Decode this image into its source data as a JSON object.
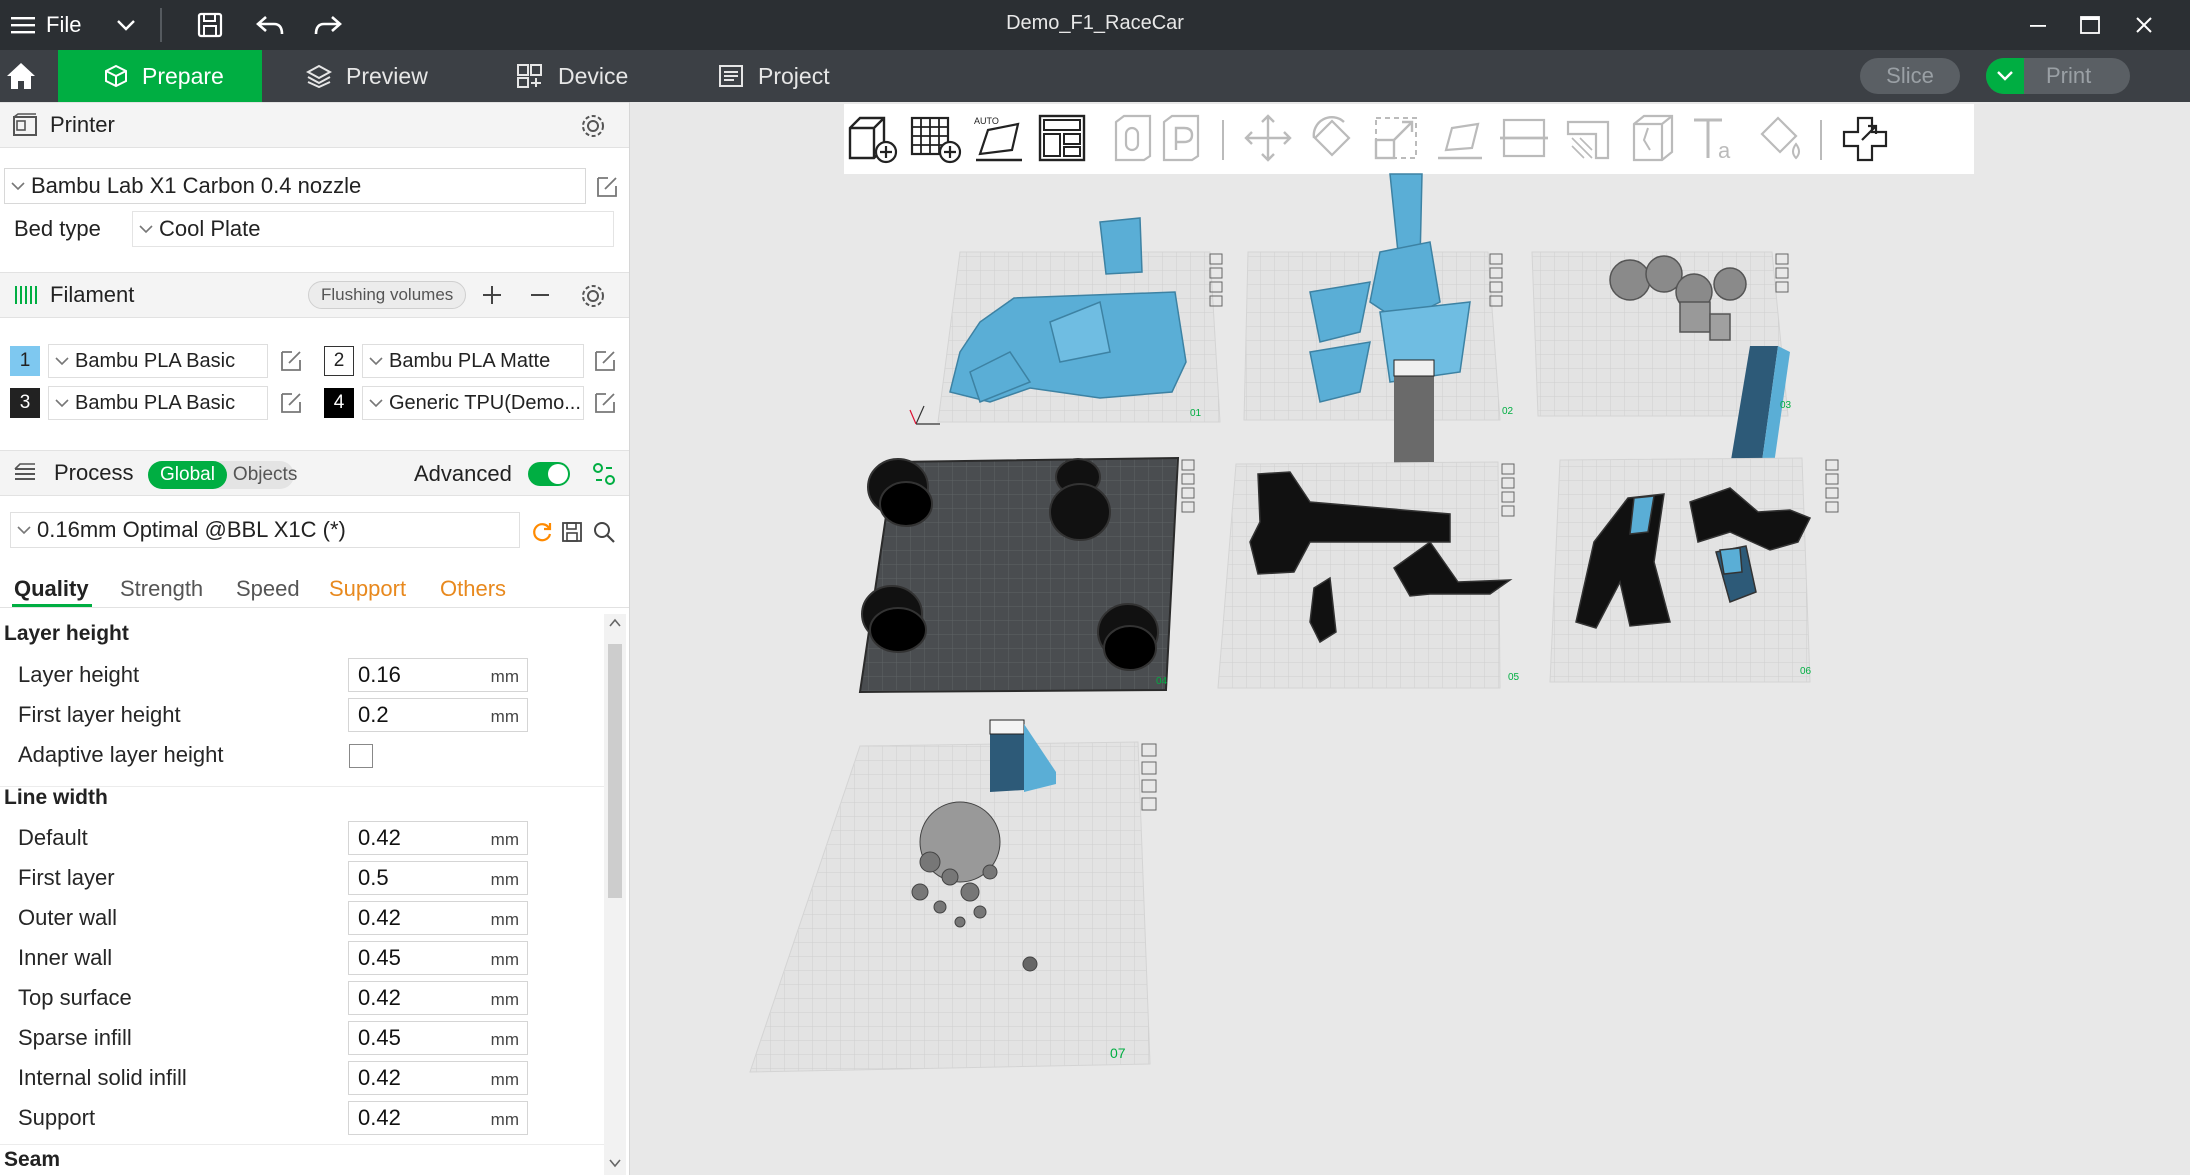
{
  "window": {
    "file_label": "File",
    "title": "Demo_F1_RaceCar"
  },
  "nav": {
    "tabs": [
      {
        "label": "Prepare",
        "active": true
      },
      {
        "label": "Preview"
      },
      {
        "label": "Device"
      },
      {
        "label": "Project"
      }
    ],
    "slice_label": "Slice",
    "print_label": "Print"
  },
  "printer": {
    "title": "Printer",
    "model": "Bambu Lab X1 Carbon 0.4 nozzle",
    "bed_type_label": "Bed type",
    "bed_type": "Cool Plate"
  },
  "filament": {
    "title": "Filament",
    "flushing_label": "Flushing volumes",
    "slots": [
      {
        "num": "1",
        "name": "Bambu PLA Basic",
        "color": "#7ec8f0"
      },
      {
        "num": "2",
        "name": "Bambu PLA Matte",
        "color": "#ffffff"
      },
      {
        "num": "3",
        "name": "Bambu PLA Basic",
        "color": "#222222"
      },
      {
        "num": "4",
        "name": "Generic TPU(Demo...",
        "color": "#000000"
      }
    ]
  },
  "process": {
    "title": "Process",
    "global_label": "Global",
    "objects_label": "Objects",
    "advanced_label": "Advanced",
    "advanced_on": true,
    "preset": "0.16mm Optimal @BBL X1C (*)",
    "tabs": [
      "Quality",
      "Strength",
      "Speed",
      "Support",
      "Others"
    ],
    "groups": {
      "layer_height": {
        "title": "Layer height",
        "options": [
          {
            "label": "Layer height",
            "value": "0.16",
            "unit": "mm"
          },
          {
            "label": "First layer height",
            "value": "0.2",
            "unit": "mm"
          }
        ],
        "adaptive_label": "Adaptive layer height",
        "adaptive_checked": false
      },
      "line_width": {
        "title": "Line width",
        "options": [
          {
            "label": "Default",
            "value": "0.42",
            "unit": "mm"
          },
          {
            "label": "First layer",
            "value": "0.5",
            "unit": "mm"
          },
          {
            "label": "Outer wall",
            "value": "0.42",
            "unit": "mm"
          },
          {
            "label": "Inner wall",
            "value": "0.45",
            "unit": "mm"
          },
          {
            "label": "Top surface",
            "value": "0.42",
            "unit": "mm"
          },
          {
            "label": "Sparse infill",
            "value": "0.45",
            "unit": "mm"
          },
          {
            "label": "Internal solid infill",
            "value": "0.42",
            "unit": "mm"
          },
          {
            "label": "Support",
            "value": "0.42",
            "unit": "mm"
          }
        ]
      },
      "seam": {
        "title": "Seam"
      }
    }
  },
  "viewport": {
    "plates": [
      "01",
      "02",
      "03",
      "04",
      "05",
      "06",
      "07"
    ],
    "accent": "#00ae42",
    "part_blue": "#5aaed6"
  }
}
